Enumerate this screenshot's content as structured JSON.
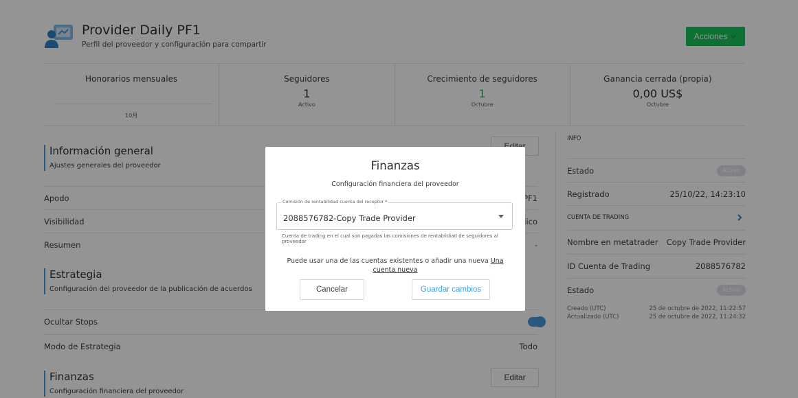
{
  "header": {
    "title": "Provider Daily PF1",
    "subtitle": "Perfil del proveedor y configuración para compartir",
    "actions_label": "Acciones"
  },
  "stats": [
    {
      "label": "Honorarios mensuales",
      "value": "",
      "sub": "",
      "month": "10月"
    },
    {
      "label": "Seguidores",
      "value": "1",
      "sub": "Activo"
    },
    {
      "label": "Crecimiento de seguidores",
      "value": "1",
      "sub": "Octubre"
    },
    {
      "label": "Ganancia cerrada (propia)",
      "value": "0,00 US$",
      "sub": "Octubre"
    }
  ],
  "general": {
    "title": "Información general",
    "desc": "Ajustes generales del proveedor",
    "edit_label": "Editar",
    "rows": [
      {
        "label": "Apodo",
        "value": "PF1"
      },
      {
        "label": "Visibilidad",
        "value": "lico"
      },
      {
        "label": "Resumen",
        "value": "-"
      }
    ]
  },
  "strategy": {
    "title": "Estrategia",
    "desc": "Configuración del proveedor de la publicación de acuerdos",
    "rows": [
      {
        "label": "Ocultar Stops",
        "value": ""
      },
      {
        "label": "Modo de Estrategia",
        "value": "Todo"
      }
    ]
  },
  "finance": {
    "title": "Finanzas",
    "desc": "Configuración financiera del proveedor",
    "edit_label": "Editar"
  },
  "info": {
    "caption": "INFO",
    "status_label": "Estado",
    "status_value": "Activo",
    "registered_label": "Registrado",
    "registered_value": "25/10/22, 14:23:10",
    "trading_caption": "CUENTA DE TRADING",
    "mt_name_label": "Nombre en metatrader",
    "mt_name_value": "Copy Trade Provider",
    "account_id_label": "ID Cuenta de Trading",
    "account_id_value": "2088576782",
    "account_status_label": "Estado",
    "account_status_value": "Activo",
    "created_label": "Creado (UTC)",
    "created_value": "25 de octubre de 2022, 11:22:57",
    "updated_label": "Actualizado (UTC)",
    "updated_value": "25 de octubre de 2022, 11:24:32"
  },
  "modal": {
    "title": "Finanzas",
    "subtitle": "Configuración financiera del proveedor",
    "field_legend": "Comisión de rentabilidad cuenta del receptor *",
    "field_value": "2088576782-Copy Trade Provider",
    "helper": "Cuenta de trading en el cual son pagadas las comisiones de rentabildiad de seguidores al proveedor",
    "note": "Puede usar una de las cuentas existentes o añadir una nueva",
    "note_link": "Una cuenta nueva",
    "cancel_label": "Cancelar",
    "save_label": "Guardar cambios"
  },
  "colors": {
    "accent_green": "#19c35a",
    "accent_blue": "#4b98d9",
    "link_blue": "#3aa3e8"
  }
}
